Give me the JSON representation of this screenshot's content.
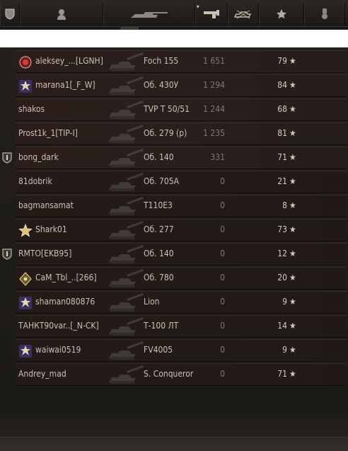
{
  "header": {
    "columns": [
      {
        "key": "left",
        "icon": "shield-icon"
      },
      {
        "key": "player",
        "icon": "player-silhouette-icon"
      },
      {
        "key": "vehicle",
        "icon": "tank-icon"
      },
      {
        "key": "damage",
        "icon": "damage-gun-icon"
      },
      {
        "key": "spotted",
        "icon": "spotted-tank-icon"
      },
      {
        "key": "xp",
        "icon": "star-icon"
      },
      {
        "key": "medal",
        "icon": "medal-icon"
      }
    ],
    "sort_indicator": "▾"
  },
  "players": [
    {
      "name": "aleksey_...[LGNH]",
      "vehicle": "Foch 155",
      "damage": "1 651",
      "xp": "79",
      "badge": "",
      "icon": "red-emblem-icon"
    },
    {
      "name": "marana1[_F_W]",
      "vehicle": "Об. 430У",
      "damage": "1 294",
      "xp": "84",
      "badge": "",
      "icon": "purple-star-emblem-icon"
    },
    {
      "name": "shakos",
      "vehicle": "TVP T 50/51",
      "damage": "1 244",
      "xp": "68",
      "badge": "",
      "icon": ""
    },
    {
      "name": "Prost1k_1[TIP-I]",
      "vehicle": "Об. 279 (р)",
      "damage": "1 235",
      "xp": "81",
      "badge": "",
      "icon": ""
    },
    {
      "name": "bong_dark",
      "vehicle": "Об. 140",
      "damage": "331",
      "xp": "71",
      "badge": "platoon-shield-icon",
      "icon": ""
    },
    {
      "name": "81dobrik",
      "vehicle": "Об. 705А",
      "damage": "0",
      "xp": "21",
      "badge": "",
      "icon": ""
    },
    {
      "name": "bagmansamat",
      "vehicle": "T110E3",
      "damage": "0",
      "xp": "8",
      "badge": "",
      "icon": ""
    },
    {
      "name": "Shark01",
      "vehicle": "Об. 277",
      "damage": "0",
      "xp": "73",
      "badge": "",
      "icon": "gold-star-emblem-icon"
    },
    {
      "name": "RMTO[EKB95]",
      "vehicle": "Об. 140",
      "damage": "0",
      "xp": "12",
      "badge": "platoon-shield-icon",
      "icon": ""
    },
    {
      "name": "CaM_Tbl_..[266]",
      "vehicle": "Об. 780",
      "damage": "0",
      "xp": "20",
      "badge": "",
      "icon": "gold-diamond-emblem-icon"
    },
    {
      "name": "shaman080876",
      "vehicle": "Lion",
      "damage": "0",
      "xp": "9",
      "badge": "",
      "icon": "purple-star-emblem-icon"
    },
    {
      "name": "ТАНКТ90var..[_N-CK]",
      "vehicle": "Т-100 ЛТ",
      "damage": "0",
      "xp": "14",
      "badge": "",
      "icon": ""
    },
    {
      "name": "waiwai0519",
      "vehicle": "FV4005",
      "damage": "0",
      "xp": "9",
      "badge": "",
      "icon": "purple-star-emblem-icon"
    },
    {
      "name": "Andrey_mad",
      "vehicle": "S. Conqueror",
      "damage": "0",
      "xp": "71",
      "badge": "",
      "icon": ""
    }
  ],
  "star_glyph": "★",
  "colors": {
    "accent": "#c9c4b3",
    "row_bg": "#2a1f1c",
    "damage_text": "#7e7a6f"
  }
}
